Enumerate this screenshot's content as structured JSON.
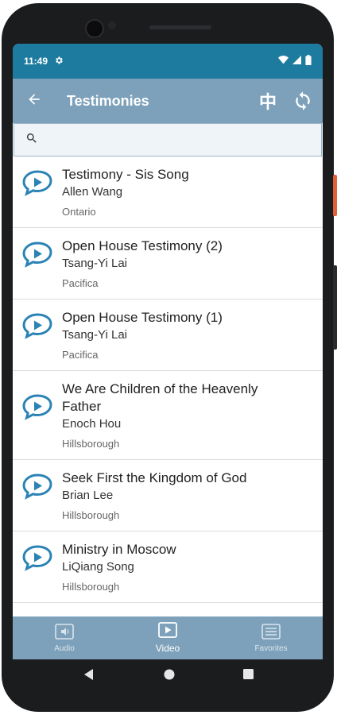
{
  "status_bar": {
    "time": "11:49",
    "icons": [
      "gear-icon",
      "wifi-icon",
      "signal-icon",
      "battery-icon"
    ]
  },
  "app_bar": {
    "title": "Testimonies",
    "language_toggle": "中",
    "icons": [
      "arrow-back-icon",
      "refresh-icon"
    ]
  },
  "search": {
    "placeholder": "",
    "value": ""
  },
  "list": {
    "items": [
      {
        "title": "Testimony - Sis Song",
        "speaker": "Allen Wang",
        "location": "Ontario"
      },
      {
        "title": "Open House Testimony (2)",
        "speaker": "Tsang-Yi Lai",
        "location": "Pacifica"
      },
      {
        "title": "Open House Testimony (1)",
        "speaker": "Tsang-Yi Lai",
        "location": "Pacifica"
      },
      {
        "title": "We Are Children of the Heavenly Father",
        "speaker": "Enoch Hou",
        "location": "Hillsborough"
      },
      {
        "title": "Seek First the Kingdom of God",
        "speaker": "Brian Lee",
        "location": "Hillsborough"
      },
      {
        "title": "Ministry in Moscow",
        "speaker": "LiQiang Song",
        "location": "Hillsborough"
      }
    ]
  },
  "bottom_nav": {
    "audio": "Audio",
    "video": "Video",
    "favorites": "Favorites",
    "active": "video"
  },
  "colors": {
    "status_bar": "#1e7ba0",
    "app_bar": "#7da1bb",
    "icon_blue": "#2a82b5",
    "search_bg": "#eef4f8"
  }
}
